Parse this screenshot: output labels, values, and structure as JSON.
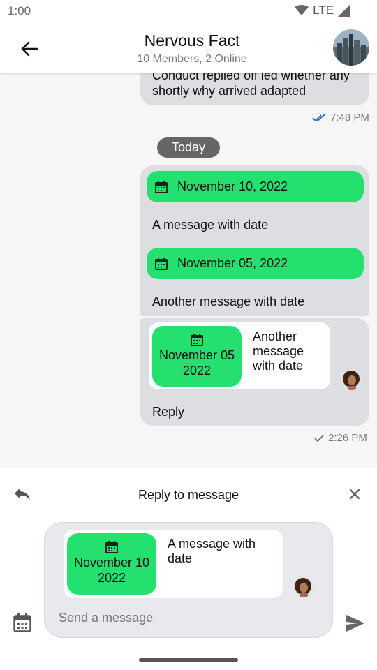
{
  "status_bar": {
    "time": "1:00",
    "network": "LTE"
  },
  "header": {
    "title": "Nervous Fact",
    "subtitle": "10 Members, 2 Online"
  },
  "messages": {
    "partial_text": "Conduct replied off led whether any shortly why arrived adapted",
    "partial_time": "7:48 PM",
    "day_separator": "Today",
    "msg1": {
      "date": "November 10, 2022",
      "text": "A message with date"
    },
    "msg2": {
      "date": "November 05, 2022",
      "text": "Another message with date"
    },
    "msg3": {
      "quoted_date_line1": "November 05",
      "quoted_date_line2": "2022",
      "quoted_text": "Another message with date",
      "text": "Reply",
      "time": "2:26 PM"
    }
  },
  "reply_panel": {
    "title": "Reply to message",
    "quoted_date_line1": "November 10",
    "quoted_date_line2": "2022",
    "quoted_text": "A message with date",
    "input_placeholder": "Send a message"
  },
  "colors": {
    "accent_green": "#24e06e",
    "bubble": "#dddee2",
    "read_tick": "#1a5fd6"
  },
  "icons": [
    "back-arrow-icon",
    "calendar-icon",
    "double-check-icon",
    "check-icon",
    "reply-icon",
    "close-icon",
    "send-icon",
    "wifi-icon",
    "signal-icon"
  ]
}
